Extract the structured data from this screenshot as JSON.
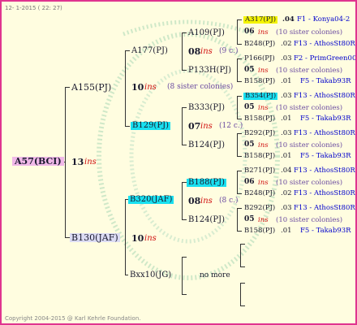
{
  "header": "12- 1-2015 ( 22: 27)",
  "footer": "Copyright 2004-2015 @ Karl Kehrle Foundation.",
  "root": {
    "name": "A57(BCI)",
    "gen": "13",
    "ins": "ins"
  },
  "gen1": {
    "sire": {
      "name": "A155(PJ)",
      "gen": "10",
      "ins": "ins",
      "note": "(8 sister colonies)"
    },
    "dam": {
      "name": "B130(JAF)",
      "gen": "10",
      "ins": "ins"
    }
  },
  "gen2": {
    "a177": {
      "name": "A177(PJ)",
      "gen": "08",
      "ins": "ins",
      "note": "(9 c.)"
    },
    "b129": {
      "name": "B129(PJ)",
      "gen": "07",
      "ins": "ins",
      "note": "(12 c.)"
    },
    "b320": {
      "name": "B320(JAF)",
      "gen": "08",
      "ins": "ins",
      "note": "(8 c.)"
    },
    "bxx10": {
      "name": "Bxx10(JG)",
      "note": "no more"
    }
  },
  "gen3": {
    "a109": "A109(PJ)",
    "p133": "P133H(PJ)",
    "b333": "B333(PJ)",
    "b124a": "B124(PJ)",
    "b188": "B188(PJ)",
    "b124b": "B124(PJ)"
  },
  "gen4": [
    {
      "name": "A317(PJ)",
      "num": ".04",
      "code": "F1 - Konya04-2"
    },
    {
      "gen": "06",
      "ins": "ins",
      "note": "(10 sister colonies)"
    },
    {
      "name": "B248(PJ)",
      "num": ".02",
      "code": "F13 - AthosSt80R"
    },
    {
      "name": "P166(PJ)",
      "num": ".03",
      "code": "F2 - PrimGreen00"
    },
    {
      "gen": "05",
      "ins": "ins",
      "note": "(10 sister colonies)"
    },
    {
      "name": "B158(PJ)",
      "num": ".01",
      "code": "F5 - Takab93R"
    },
    {
      "name": "B354(PJ)",
      "num": ".03",
      "code": "F13 - AthosSt80R"
    },
    {
      "gen": "05",
      "ins": "ins",
      "note": "(10 sister colonies)"
    },
    {
      "name": "B158(PJ)",
      "num": ".01",
      "code": "F5 - Takab93R"
    },
    {
      "name": "B292(PJ)",
      "num": ".03",
      "code": "F13 - AthosSt80R"
    },
    {
      "gen": "05",
      "ins": "ins",
      "note": "(10 sister colonies)"
    },
    {
      "name": "B158(PJ)",
      "num": ".01",
      "code": "F5 - Takab93R"
    },
    {
      "name": "B271(PJ)",
      "num": ".04",
      "code": "F13 - AthosSt80R"
    },
    {
      "gen": "06",
      "ins": "ins",
      "note": "(10 sister colonies)"
    },
    {
      "name": "B248(PJ)",
      "num": ".02",
      "code": "F13 - AthosSt80R"
    },
    {
      "name": "B292(PJ)",
      "num": ".03",
      "code": "F13 - AthosSt80R"
    },
    {
      "gen": "05",
      "ins": "ins",
      "note": "(10 sister colonies)"
    },
    {
      "name": "B158(PJ)",
      "num": ".01",
      "code": "F5 - Takab93R"
    }
  ]
}
